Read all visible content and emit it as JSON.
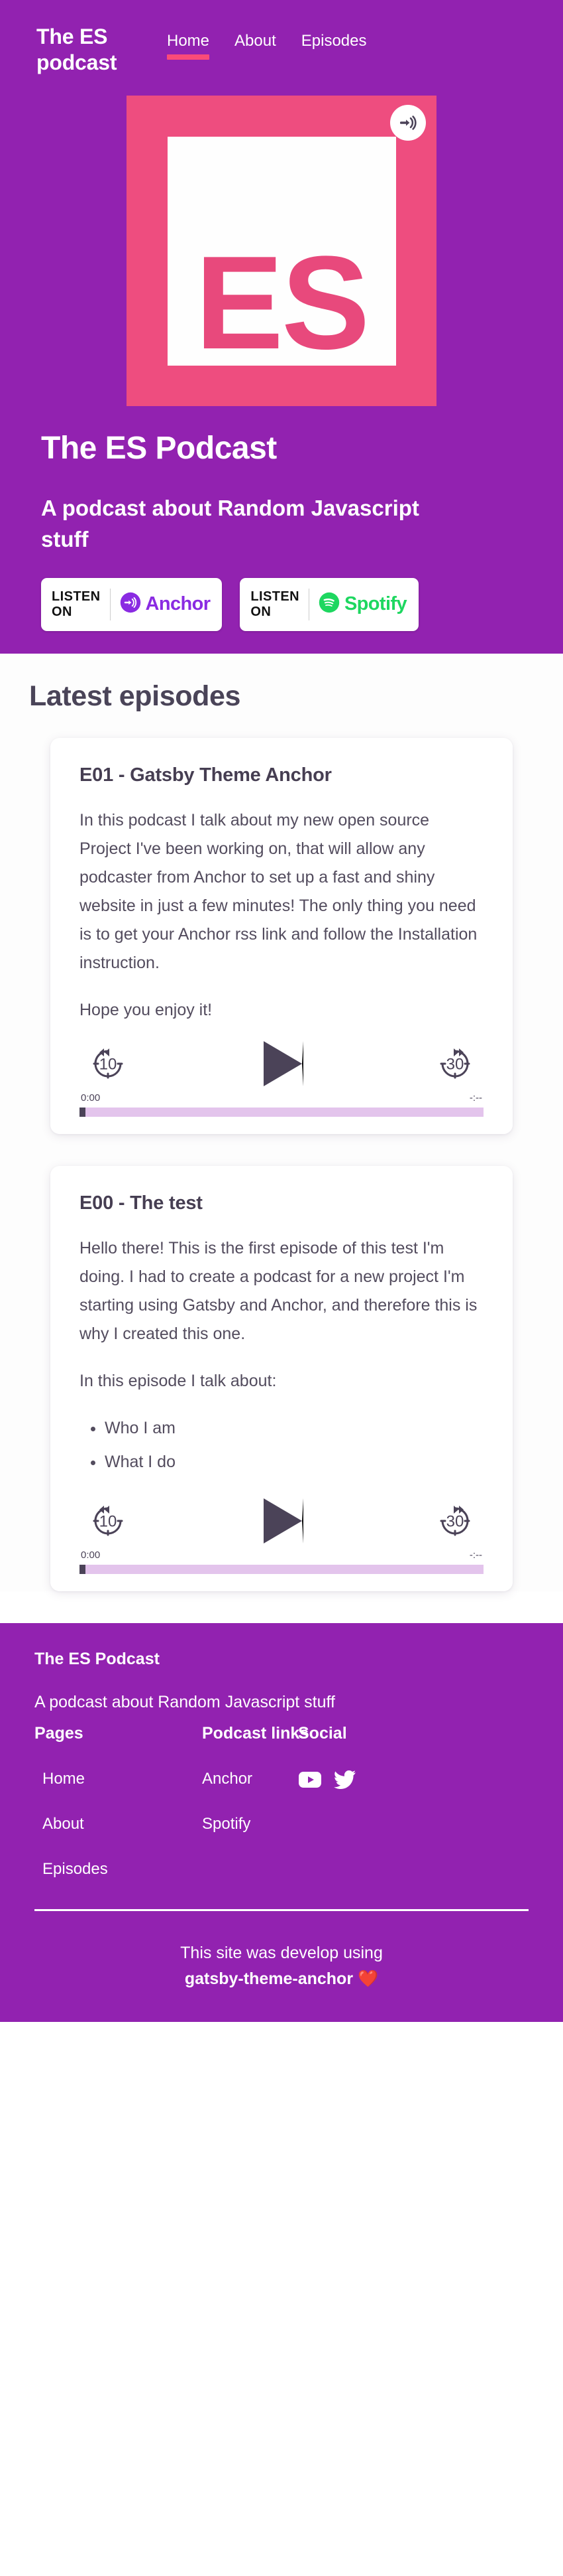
{
  "colors": {
    "purple": "#9222B0",
    "pink_accent": "#FA4B78",
    "art_pink": "#EE4D7F",
    "anchor_purple": "#8A2BE2",
    "spotify_green": "#1ED760",
    "text_dark": "#4A4458",
    "progress_track": "#E3C4EC"
  },
  "header": {
    "brand": "The ES podcast",
    "nav": [
      {
        "label": "Home",
        "active": true
      },
      {
        "label": "About",
        "active": false
      },
      {
        "label": "Episodes",
        "active": false
      }
    ]
  },
  "hero": {
    "artwork_text": "ES",
    "artwork_badge_icon": "anchor-podcast-icon",
    "title": "The ES Podcast",
    "subtitle": "A podcast about Random Javascript stuff",
    "badges": [
      {
        "listen_label": "LISTEN\nON",
        "platform": "Anchor",
        "icon": "anchor-icon"
      },
      {
        "listen_label": "LISTEN\nON",
        "platform": "Spotify",
        "icon": "spotify-icon"
      }
    ]
  },
  "main": {
    "section_title": "Latest episodes",
    "episodes": [
      {
        "title": "E01 - Gatsby Theme Anchor",
        "paragraphs": [
          "In this podcast I talk about my new open source Project I've been working on, that will allow any podcaster from Anchor to set up a fast and shiny website in just a few minutes! The only thing you need is to get your Anchor rss link and follow the Installation instruction.",
          "Hope you enjoy it!"
        ],
        "bullets": [],
        "player": {
          "rewind_label": "10",
          "forward_label": "30",
          "play_icon": "play-icon",
          "current_time": "0:00",
          "duration": "-:--",
          "progress_percent": 0
        }
      },
      {
        "title": "E00 - The test",
        "paragraphs": [
          "Hello there! This is the first episode of this test I'm doing. I had to create a podcast for a new project I'm starting using Gatsby and Anchor, and therefore this is why I created this one.",
          "In this episode I talk about:"
        ],
        "bullets": [
          "Who I am",
          "What I do"
        ],
        "player": {
          "rewind_label": "10",
          "forward_label": "30",
          "play_icon": "play-icon",
          "current_time": "0:00",
          "duration": "-:--",
          "progress_percent": 0
        }
      }
    ]
  },
  "footer": {
    "brand": "The ES Podcast",
    "tagline": "A podcast about Random Javascript stuff",
    "pages_heading": "Pages",
    "pages": [
      "Home",
      "About",
      "Episodes"
    ],
    "links_heading": "Podcast links",
    "links": [
      "Anchor",
      "Spotify"
    ],
    "social_heading": "Social",
    "social": [
      {
        "name": "youtube-icon"
      },
      {
        "name": "twitter-icon"
      }
    ],
    "credit_line1": "This site was develop using",
    "credit_theme": "gatsby-theme-anchor",
    "credit_emoji": "❤️"
  }
}
